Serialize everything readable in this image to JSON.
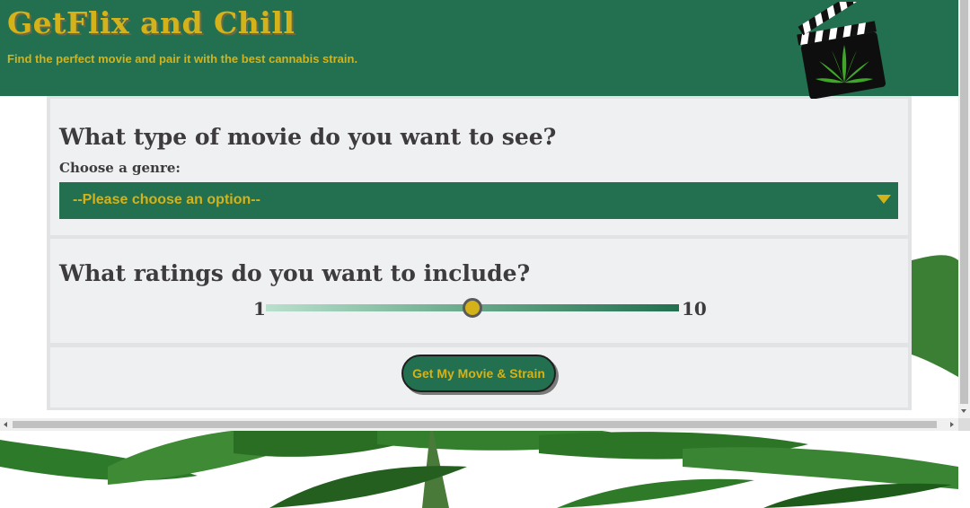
{
  "header": {
    "title": "GetFlix and Chill",
    "tagline": "Find the perfect movie and pair it with the best cannabis strain."
  },
  "genre_section": {
    "question": "What type of movie do you want to see?",
    "label": "Choose a genre:",
    "select_value": "--Please choose an option--"
  },
  "ratings_section": {
    "question": "What ratings do you want to include?",
    "min_label": "1",
    "max_label": "10",
    "slider_value": 5.5
  },
  "submit": {
    "label": "Get My Movie & Strain"
  },
  "icons": [
    "clapperboard-cannabis-logo",
    "chevron-down-icon"
  ],
  "colors": {
    "brand_green": "#227050",
    "brand_gold": "#d4b21a",
    "panel_bg": "#eff0f2",
    "text_dark": "#3d3b3d"
  }
}
